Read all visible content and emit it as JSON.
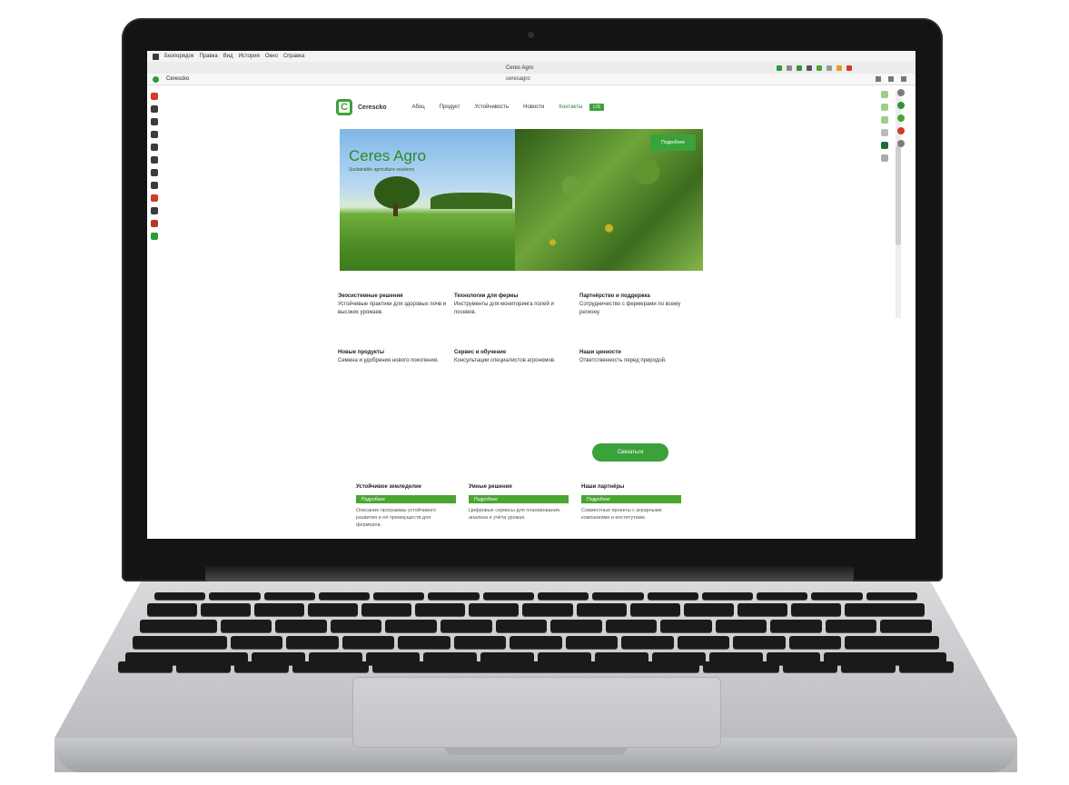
{
  "browser": {
    "menu_items": [
      "Безпорядок",
      "Правка",
      "Вид",
      "История",
      "Окно",
      "Справка"
    ],
    "tab_title": "Ceres Agro",
    "address": "ceresagro",
    "url_left": "Cerescko"
  },
  "site": {
    "brand": "Cerescko",
    "nav": [
      "Абоц",
      "Продукт",
      "Устойчивость",
      "Новости",
      "Контакты"
    ],
    "nav_badge": "LIS",
    "hero": {
      "title": "Ceres Agro",
      "subtitle": "Sustainable agriculture solutions",
      "button": "Подробнее"
    },
    "columns": [
      {
        "heading": "Экосистемные решения",
        "body": "Устойчивые практики для здоровых почв и высоких урожаев."
      },
      {
        "heading": "Технологии для фермы",
        "body": "Инструменты для мониторинга полей и посевов."
      },
      {
        "heading": "Партнёрство и поддержка",
        "body": "Сотрудничество с фермерами по всему региону."
      },
      {
        "heading": "Новые продукты",
        "body": "Семена и удобрения нового поколения."
      },
      {
        "heading": "Сервис и обучение",
        "body": "Консультации специалистов агрономов."
      },
      {
        "heading": "Наши ценности",
        "body": "Ответственность перед природой."
      }
    ],
    "cta": "Связаться",
    "cards": [
      {
        "heading": "Устойчивое земледелие",
        "bar": "Подробнее",
        "text": "Описание программы устойчивого развития и её преимуществ для фермеров."
      },
      {
        "heading": "Умные решения",
        "bar": "Подробнее",
        "text": "Цифровые сервисы для планирования, анализа и учёта урожая."
      },
      {
        "heading": "Наши партнёры",
        "bar": "Подробнее",
        "text": "Совместные проекты с аграрными компаниями и институтами."
      }
    ]
  }
}
